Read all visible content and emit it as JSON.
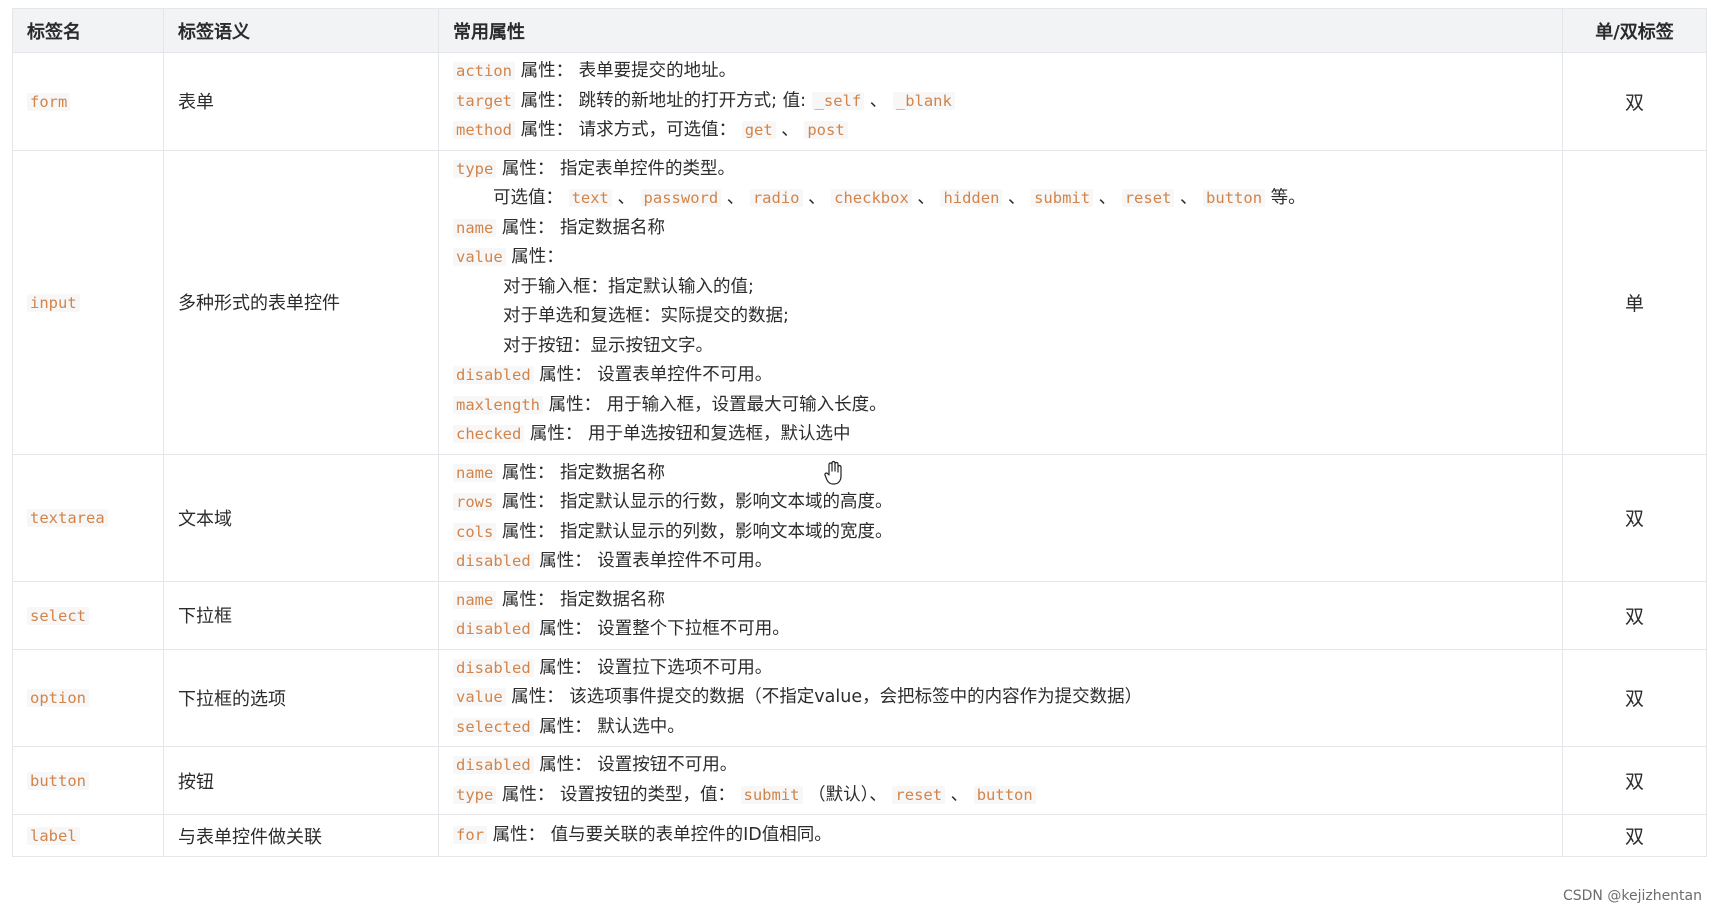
{
  "headers": {
    "tag": "标签名",
    "semantic": "标签语义",
    "attrs": "常用属性",
    "type": "单/双标签"
  },
  "rows": [
    {
      "tag": "form",
      "semantic": "表单",
      "type": "双",
      "lines": [
        {
          "indent": 0,
          "parts": [
            {
              "code": "action"
            },
            {
              "text": " 属性： 表单要提交的地址。"
            }
          ]
        },
        {
          "indent": 0,
          "parts": [
            {
              "code": "target"
            },
            {
              "text": " 属性： 跳转的新地址的打开方式; 值: "
            },
            {
              "code": "_self"
            },
            {
              "text": " 、 "
            },
            {
              "code": "_blank"
            }
          ]
        },
        {
          "indent": 0,
          "parts": [
            {
              "code": "method"
            },
            {
              "text": " 属性： 请求方式，可选值： "
            },
            {
              "code": "get"
            },
            {
              "text": " 、 "
            },
            {
              "code": "post"
            }
          ]
        }
      ]
    },
    {
      "tag": "input",
      "semantic": "多种形式的表单控件",
      "type": "单",
      "lines": [
        {
          "indent": 0,
          "parts": [
            {
              "code": "type"
            },
            {
              "text": " 属性： 指定表单控件的类型。"
            }
          ]
        },
        {
          "indent": 1,
          "parts": [
            {
              "text": "可选值： "
            },
            {
              "code": "text"
            },
            {
              "text": " 、 "
            },
            {
              "code": "password"
            },
            {
              "text": " 、 "
            },
            {
              "code": "radio"
            },
            {
              "text": " 、 "
            },
            {
              "code": "checkbox"
            },
            {
              "text": " 、 "
            },
            {
              "code": "hidden"
            },
            {
              "text": " 、 "
            },
            {
              "code": "submit"
            },
            {
              "text": " 、 "
            },
            {
              "code": "reset"
            },
            {
              "text": " 、 "
            },
            {
              "code": "button"
            },
            {
              "text": " 等。"
            }
          ]
        },
        {
          "indent": 0,
          "parts": [
            {
              "code": "name"
            },
            {
              "text": " 属性： 指定数据名称"
            }
          ]
        },
        {
          "indent": 0,
          "parts": [
            {
              "code": "value"
            },
            {
              "text": " 属性："
            }
          ]
        },
        {
          "indent": 2,
          "parts": [
            {
              "text": "对于输入框：指定默认输入的值;"
            }
          ]
        },
        {
          "indent": 2,
          "parts": [
            {
              "text": "对于单选和复选框：实际提交的数据;"
            }
          ]
        },
        {
          "indent": 2,
          "parts": [
            {
              "text": "对于按钮：显示按钮文字。"
            }
          ]
        },
        {
          "indent": 0,
          "parts": [
            {
              "code": "disabled"
            },
            {
              "text": " 属性： 设置表单控件不可用。"
            }
          ]
        },
        {
          "indent": 0,
          "parts": [
            {
              "code": "maxlength"
            },
            {
              "text": " 属性： 用于输入框，设置最大可输入长度。"
            }
          ]
        },
        {
          "indent": 0,
          "parts": [
            {
              "code": "checked"
            },
            {
              "text": " 属性： 用于单选按钮和复选框，默认选中"
            }
          ]
        }
      ]
    },
    {
      "tag": "textarea",
      "semantic": "文本域",
      "type": "双",
      "lines": [
        {
          "indent": 0,
          "parts": [
            {
              "code": "name"
            },
            {
              "text": " 属性： 指定数据名称"
            }
          ]
        },
        {
          "indent": 0,
          "parts": [
            {
              "code": "rows"
            },
            {
              "text": " 属性： 指定默认显示的行数，影响文本域的高度。"
            }
          ]
        },
        {
          "indent": 0,
          "parts": [
            {
              "code": "cols"
            },
            {
              "text": " 属性： 指定默认显示的列数，影响文本域的宽度。"
            }
          ]
        },
        {
          "indent": 0,
          "parts": [
            {
              "code": "disabled"
            },
            {
              "text": " 属性： 设置表单控件不可用。"
            }
          ]
        }
      ]
    },
    {
      "tag": "select",
      "semantic": "下拉框",
      "type": "双",
      "lines": [
        {
          "indent": 0,
          "parts": [
            {
              "code": "name"
            },
            {
              "text": " 属性： 指定数据名称"
            }
          ]
        },
        {
          "indent": 0,
          "parts": [
            {
              "code": "disabled"
            },
            {
              "text": " 属性： 设置整个下拉框不可用。"
            }
          ]
        }
      ]
    },
    {
      "tag": "option",
      "semantic": "下拉框的选项",
      "type": "双",
      "lines": [
        {
          "indent": 0,
          "parts": [
            {
              "code": "disabled"
            },
            {
              "text": " 属性： 设置拉下选项不可用。"
            }
          ]
        },
        {
          "indent": 0,
          "parts": [
            {
              "code": "value"
            },
            {
              "text": " 属性： 该选项事件提交的数据（不指定value，会把标签中的内容作为提交数据）"
            }
          ]
        },
        {
          "indent": 0,
          "parts": [
            {
              "code": "selected"
            },
            {
              "text": " 属性： 默认选中。"
            }
          ]
        }
      ]
    },
    {
      "tag": "button",
      "semantic": "按钮",
      "type": "双",
      "lines": [
        {
          "indent": 0,
          "parts": [
            {
              "code": "disabled"
            },
            {
              "text": " 属性： 设置按钮不可用。"
            }
          ]
        },
        {
          "indent": 0,
          "parts": [
            {
              "code": "type"
            },
            {
              "text": " 属性： 设置按钮的类型，值： "
            },
            {
              "code": "submit"
            },
            {
              "text": " （默认）、 "
            },
            {
              "code": "reset"
            },
            {
              "text": " 、 "
            },
            {
              "code": "button"
            }
          ]
        }
      ]
    },
    {
      "tag": "label",
      "semantic": "与表单控件做关联",
      "type": "双",
      "lines": [
        {
          "indent": 0,
          "parts": [
            {
              "code": "for"
            },
            {
              "text": " 属性： 值与要关联的表单控件的ID值相同。"
            }
          ]
        }
      ]
    }
  ],
  "watermark": "CSDN @kejizhentan"
}
